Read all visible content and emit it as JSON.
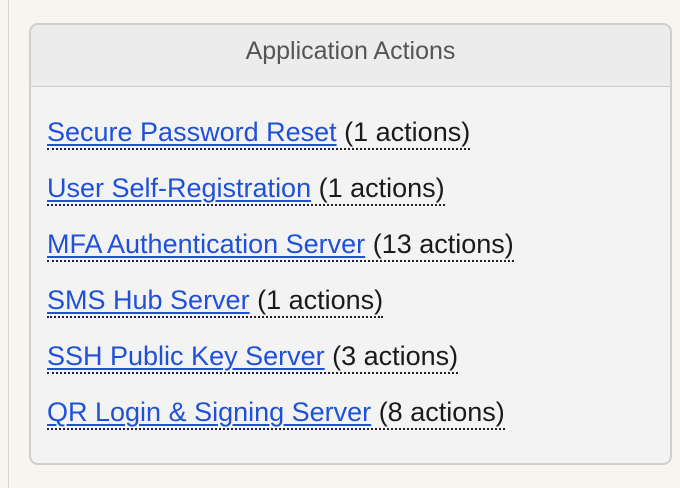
{
  "panel": {
    "title": "Application Actions",
    "items": [
      {
        "label": "Secure Password Reset",
        "count": "(1 actions)"
      },
      {
        "label": "User Self-Registration",
        "count": "(1 actions)"
      },
      {
        "label": "MFA Authentication Server",
        "count": "(13 actions)"
      },
      {
        "label": "SMS Hub Server",
        "count": "(1 actions)"
      },
      {
        "label": "SSH Public Key Server",
        "count": "(3 actions)"
      },
      {
        "label": "QR Login & Signing Server",
        "count": "(8 actions)"
      }
    ]
  },
  "colors": {
    "link": "#1f51d8",
    "text": "#1a1a1a",
    "panel_background": "#f3f3f3",
    "header_background": "#ececec",
    "border": "#cfcfcf",
    "page_background": "#f6f5ef"
  }
}
